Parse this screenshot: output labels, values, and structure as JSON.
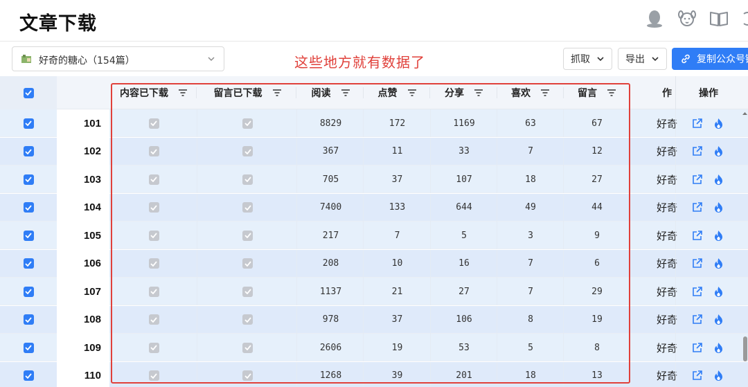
{
  "page": {
    "title": "文章下载"
  },
  "header_icons": [
    "qq-icon",
    "dog-icon",
    "book-icon",
    "refresh-icon"
  ],
  "toolbar": {
    "account_select": "好奇的糖心（154篇）",
    "annotation": "这些地方就有数据了",
    "fetch_label": "抓取",
    "export_label": "导出",
    "copy_label": "复制公众号链"
  },
  "columns": {
    "content_downloaded": "内容已下载",
    "comments_downloaded": "留言已下载",
    "reads": "阅读",
    "likes": "点赞",
    "shares": "分享",
    "favorites": "喜欢",
    "comments": "留言",
    "author": "作",
    "actions": "操作"
  },
  "rows": [
    {
      "id": "101",
      "reads": "8829",
      "likes": "172",
      "shares": "1169",
      "favorites": "63",
      "comments": "67",
      "author": "好奇"
    },
    {
      "id": "102",
      "reads": "367",
      "likes": "11",
      "shares": "33",
      "favorites": "7",
      "comments": "12",
      "author": "好奇"
    },
    {
      "id": "103",
      "reads": "705",
      "likes": "37",
      "shares": "107",
      "favorites": "18",
      "comments": "27",
      "author": "好奇"
    },
    {
      "id": "104",
      "reads": "7400",
      "likes": "133",
      "shares": "644",
      "favorites": "49",
      "comments": "44",
      "author": "好奇"
    },
    {
      "id": "105",
      "reads": "217",
      "likes": "7",
      "shares": "5",
      "favorites": "3",
      "comments": "9",
      "author": "好奇"
    },
    {
      "id": "106",
      "reads": "208",
      "likes": "10",
      "shares": "16",
      "favorites": "7",
      "comments": "6",
      "author": "好奇"
    },
    {
      "id": "107",
      "reads": "1137",
      "likes": "21",
      "shares": "27",
      "favorites": "7",
      "comments": "29",
      "author": "好奇"
    },
    {
      "id": "108",
      "reads": "978",
      "likes": "37",
      "shares": "106",
      "favorites": "8",
      "comments": "19",
      "author": "好奇"
    },
    {
      "id": "109",
      "reads": "2606",
      "likes": "19",
      "shares": "53",
      "favorites": "5",
      "comments": "8",
      "author": "好奇"
    },
    {
      "id": "110",
      "reads": "1268",
      "likes": "39",
      "shares": "201",
      "favorites": "18",
      "comments": "13",
      "author": "好奇"
    }
  ],
  "colors": {
    "accent": "#2f7df6",
    "annotation": "#e0403a",
    "row_bg": "#e6f0fb",
    "fire": "#2f7df6"
  }
}
